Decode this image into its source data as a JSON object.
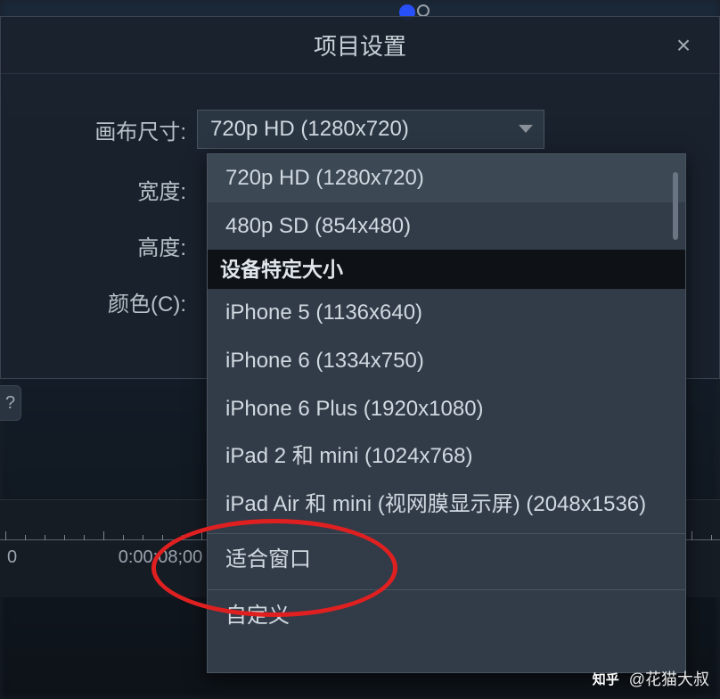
{
  "dialog": {
    "title": "项目设置",
    "close_icon": "×"
  },
  "form": {
    "canvas_size_label": "画布尺寸:",
    "canvas_size_value": "720p HD (1280x720)",
    "width_label": "宽度:",
    "height_label": "高度:",
    "color_label": "颜色(C):"
  },
  "dropdown": {
    "options": [
      {
        "label": "720p HD (1280x720)",
        "highlight": true
      },
      {
        "label": "480p SD (854x480)"
      },
      {
        "label": "设备特定大小",
        "group_header": true
      },
      {
        "label": "iPhone 5 (1136x640)"
      },
      {
        "label": "iPhone 6 (1334x750)"
      },
      {
        "label": "iPhone 6 Plus (1920x1080)"
      },
      {
        "label": "iPad 2 和 mini (1024x768)"
      },
      {
        "label": "iPad Air 和 mini (视网膜显示屏) (2048x1536)"
      },
      {
        "label": "适合窗口",
        "sep_top": true
      },
      {
        "label": "自定义",
        "sep_top": true
      }
    ]
  },
  "help": {
    "label": "?"
  },
  "timeline": {
    "t0": "0",
    "t1": "0:00:08;00"
  },
  "watermark": {
    "logo": "知乎",
    "text": "@花猫大叔"
  }
}
